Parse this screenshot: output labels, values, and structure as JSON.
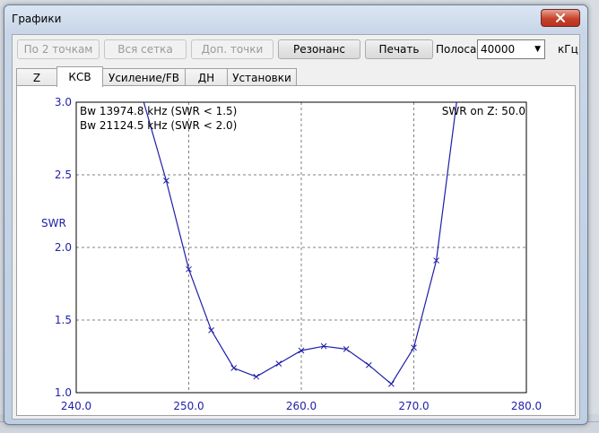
{
  "window": {
    "title": "Графики"
  },
  "toolbar": {
    "by_2_points": "По 2 точкам",
    "full_grid": "Вся сетка",
    "extra_points": "Доп. точки",
    "resonance": "Резонанс",
    "print": "Печать",
    "band_label": "Полоса",
    "band_value": "40000",
    "band_unit": "кГц"
  },
  "tabs": [
    "Z",
    "КСВ",
    "Усиление/FB",
    "ДН",
    "Установки"
  ],
  "icons": {
    "close": "close-icon",
    "dropdown": "chevron-down-icon"
  },
  "colors": {
    "curve": "#1e1ea8",
    "grid": "#808080"
  },
  "chart_data": {
    "type": "line",
    "ylabel": "SWR",
    "xlim": [
      240.0,
      280.0
    ],
    "ylim": [
      1.0,
      3.0
    ],
    "x_ticks": [
      "240.0",
      "250.0",
      "260.0",
      "270.0",
      "280.0"
    ],
    "y_ticks": [
      "1.0",
      "1.5",
      "2.0",
      "2.5",
      "3.0"
    ],
    "grid": true,
    "annotations": {
      "bw1": "Bw 13974.8 kHz (SWR < 1.5)",
      "bw2": "Bw 21124.5 kHz (SWR < 2.0)",
      "swr_on_z": "SWR on Z: 50.0"
    },
    "series": [
      {
        "x": [
          246.0,
          248.0,
          250.0,
          252.0,
          254.0,
          256.0,
          258.0,
          260.0,
          262.0,
          264.0,
          266.0,
          268.0,
          270.0,
          272.0,
          273.8
        ],
        "values": [
          3.0,
          2.46,
          1.85,
          1.43,
          1.17,
          1.11,
          1.2,
          1.29,
          1.32,
          1.3,
          1.19,
          1.06,
          1.31,
          1.91,
          3.0
        ]
      }
    ]
  }
}
